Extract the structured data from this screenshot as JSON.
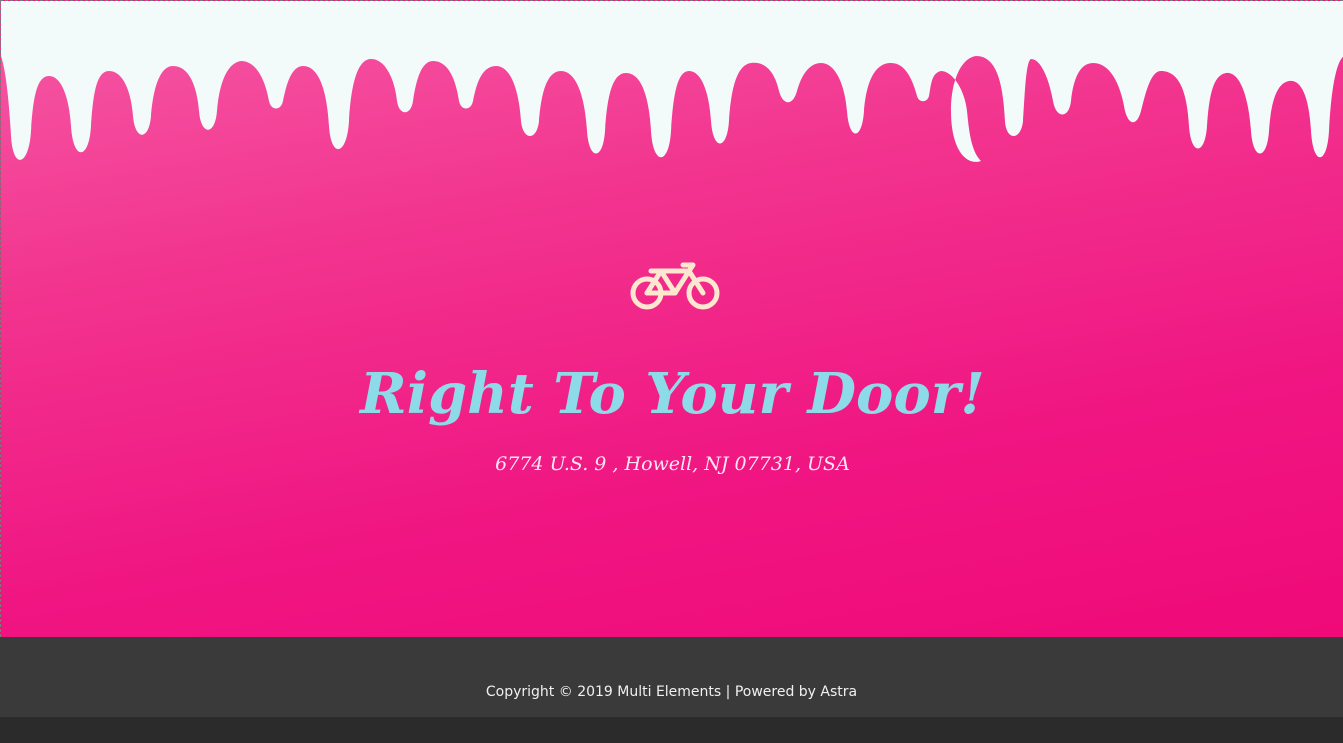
{
  "hero": {
    "headline": "Right To Your Door!",
    "address": "6774 U.S. 9 , Howell, NJ 07731, USA",
    "icon": "bicycle-icon",
    "colors": {
      "background_top": "#f65aa6",
      "background_bottom": "#ef0a78",
      "drip": "#f2fbfa",
      "headline": "#8ddbe8",
      "icon": "#fde8cf"
    }
  },
  "footer": {
    "copyright": "Copyright © 2019 Multi Elements | Powered by Astra",
    "background": "#3a3a3a"
  }
}
